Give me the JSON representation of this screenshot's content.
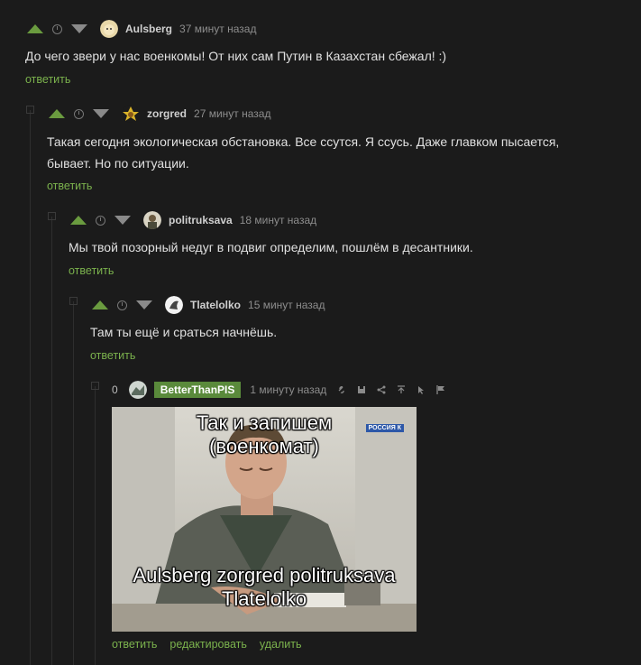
{
  "comments": [
    {
      "author": "Aulsberg",
      "time": "37 минут назад",
      "text": "До чего звери у нас военкомы! От них сам Путин в Казахстан сбежал! :)",
      "reply": "ответить"
    },
    {
      "author": "zorgred",
      "time": "27 минут назад",
      "text_line1": "Такая сегодня экологическая обстановка. Все ссутся. Я ссусь. Даже главком пысается,",
      "text_line2": "бывает. Но по ситуации.",
      "reply": "ответить"
    },
    {
      "author": "politruksava",
      "time": "18 минут назад",
      "text": "Мы твой позорный недуг в подвиг определим, пошлём в десантники.",
      "reply": "ответить"
    },
    {
      "author": "Tlatelolko",
      "time": "15 минут назад",
      "text": "Там ты ещё и сраться начнёшь.",
      "reply": "ответить"
    }
  ],
  "own_comment": {
    "rating": "0",
    "author": "BetterThanPIS",
    "time": "1 минуту назад",
    "meme": {
      "caption_top_line1": "Так и запишем",
      "caption_top_line2": "(военкомат)",
      "channel_logo": "РОССИЯ К",
      "caption_bottom_line1": "Aulsberg  zorgred politruksava",
      "caption_bottom_line2": "Tlatelolko"
    },
    "actions": {
      "reply": "ответить",
      "edit": "редактировать",
      "delete": "удалить"
    }
  },
  "colors": {
    "background": "#1b1b1b",
    "vote_up": "#6a9b3f",
    "link": "#7bb24d",
    "own_author_badge": "#5a8a3b"
  },
  "icons": [
    "clock-icon",
    "link-icon",
    "save-icon",
    "share-icon",
    "arrow-up-icon",
    "cursor-icon",
    "flag-icon"
  ]
}
